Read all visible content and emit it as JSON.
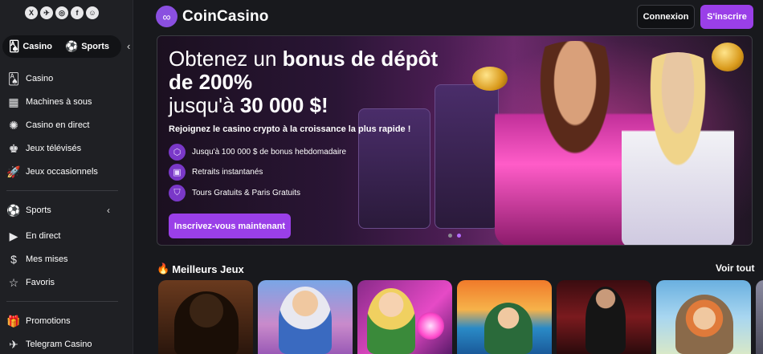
{
  "socials": [
    {
      "name": "x-icon",
      "glyph": "X"
    },
    {
      "name": "telegram-icon",
      "glyph": "✈"
    },
    {
      "name": "instagram-icon",
      "glyph": "◎"
    },
    {
      "name": "facebook-icon",
      "glyph": "f"
    },
    {
      "name": "discord-icon",
      "glyph": "☺"
    }
  ],
  "sidebar": {
    "switch": {
      "casino": "Casino",
      "sports": "Sports"
    },
    "casino_items": [
      {
        "label": "Casino",
        "icon": "cards-icon",
        "glyph": "🂡"
      },
      {
        "label": "Machines à sous",
        "icon": "slot-machine-icon",
        "glyph": "▦"
      },
      {
        "label": "Casino en direct",
        "icon": "roulette-icon",
        "glyph": "✺"
      },
      {
        "label": "Jeux télévisés",
        "icon": "tv-game-icon",
        "glyph": "♚"
      },
      {
        "label": "Jeux occasionnels",
        "icon": "rocket-icon",
        "glyph": "🚀"
      }
    ],
    "sports_items": [
      {
        "label": "Sports",
        "icon": "sports-icon",
        "glyph": "⚽"
      },
      {
        "label": "En direct",
        "icon": "play-icon",
        "glyph": "▶"
      },
      {
        "label": "Mes mises",
        "icon": "coins-icon",
        "glyph": "$"
      },
      {
        "label": "Favoris",
        "icon": "star-icon",
        "glyph": "☆"
      }
    ],
    "extra_items": [
      {
        "label": "Promotions",
        "icon": "gift-icon",
        "glyph": "🎁"
      },
      {
        "label": "Telegram Casino",
        "icon": "telegram-casino-icon",
        "glyph": "✈"
      }
    ]
  },
  "header": {
    "brand": "CoinCasino",
    "login": "Connexion",
    "signup": "S'inscrire"
  },
  "banner": {
    "title_pre": "Obtenez un ",
    "title_bold": "bonus de dépôt de 200%",
    "title_line3_pre": "jusqu'à ",
    "title_line3_bold": "30 000 $!",
    "subtitle": "Rejoignez le casino crypto à la croissance la plus rapide !",
    "features": [
      "Jusqu'à 100 000 $ de bonus hebdomadaire",
      "Retraits instantanés",
      "Tours Gratuits & Paris Gratuits"
    ],
    "cta": "Inscrivez-vous maintenant"
  },
  "section": {
    "title": "Meilleurs Jeux",
    "see_all": "Voir tout"
  },
  "colors": {
    "accent": "#9a3fe8",
    "background": "#18191d",
    "sidebar": "#1f2024"
  }
}
